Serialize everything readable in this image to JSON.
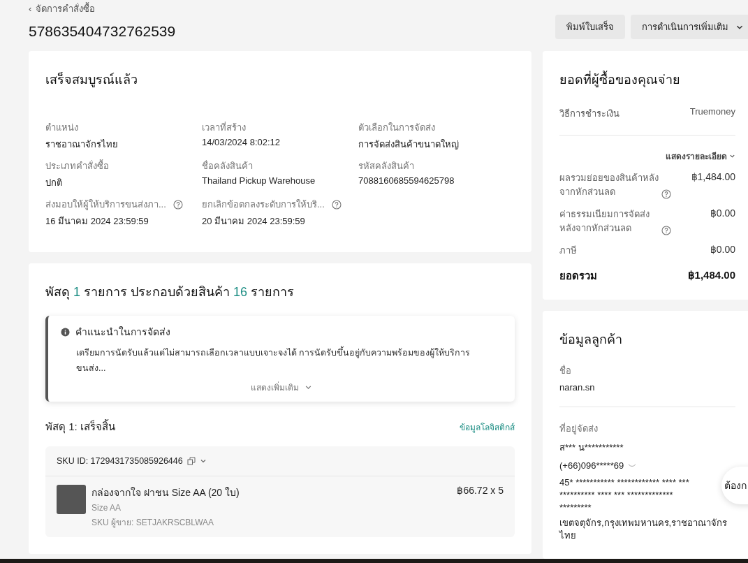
{
  "breadcrumb": {
    "icon": "‹",
    "label": "จัดการคำสั่งซื้อ"
  },
  "order_id": "578635404732762539",
  "header_buttons": [
    {
      "label": "พิมพ์ใบเสร็จ",
      "dropdown": false
    },
    {
      "label": "การดำเนินการเพิ่มเติม",
      "dropdown": true
    }
  ],
  "status_card": {
    "title": "เสร็จสมบูรณ์แล้ว",
    "fields": [
      {
        "label": "ตำแหน่ง",
        "value": "ราชอาณาจักรไทย",
        "help": false
      },
      {
        "label": "เวลาที่สร้าง",
        "value": "14/03/2024 8:02:12",
        "help": false
      },
      {
        "label": "ตัวเลือกในการจัดส่ง",
        "value": "การจัดส่งสินค้าขนาดใหญ่",
        "help": false
      },
      {
        "label": "ประเภทคำสั่งซื้อ",
        "value": "ปกติ",
        "help": false
      },
      {
        "label": "ชื่อคลังสินค้า",
        "value": "Thailand Pickup Warehouse",
        "help": false
      },
      {
        "label": "รหัสคลังสินค้า",
        "value": "7088160685594625798",
        "help": false
      },
      {
        "label": "ส่งมอบให้ผู้ให้บริการขนส่งภา...",
        "value": "16 มีนาคม 2024 23:59:59",
        "help": true
      },
      {
        "label": "ยกเลิกข้อตกลงระดับการให้บริ...",
        "value": "20 มีนาคม 2024 23:59:59",
        "help": true
      }
    ]
  },
  "packages_card": {
    "title_parts": [
      {
        "text": "พัสดุ ",
        "accent": false
      },
      {
        "text": "1",
        "accent": true
      },
      {
        "text": " รายการ ประกอบด้วยสินค้า ",
        "accent": false
      },
      {
        "text": "16",
        "accent": true
      },
      {
        "text": " รายการ",
        "accent": false
      }
    ],
    "tip": {
      "title": "คำแนะนำในการจัดส่ง",
      "body": "เตรียมการนัดรับแล้วแต่ไม่สามารถเลือกเวลาแบบเจาะจงได้ การนัดรับขึ้นอยู่กับความพร้อมของผู้ให้บริการขนส่ง...",
      "more": "แสดงเพิ่มเติม"
    },
    "package": {
      "title": "พัสดุ 1: เสร็จสิ้น",
      "link": "ข้อมูลโลจิสติกส์",
      "sku_id": "SKU ID: 1729431735085926446",
      "item": {
        "name": "กล่องจากใจ ฝาชน Size AA (20 ใบ)",
        "variant": "Size AA",
        "seller_sku": "SKU ผู้ขาย: SETJAKRSCBLWAA",
        "price": "฿66.72 x 5"
      }
    }
  },
  "payment_card": {
    "title": "ยอดที่ผู้ซื้อของคุณจ่าย",
    "method_label": "วิธีการชำระเงิน",
    "method_value": "Truemoney",
    "details_link": "แสดงรายละเอียด",
    "rows": [
      {
        "label": "ผลรวมย่อยของสินค้าหลังจากหักส่วนลด",
        "value": "฿1,484.00",
        "help": true,
        "kind": "normal"
      },
      {
        "label": "ค่าธรรมเนียมการจัดส่งหลังจากหักส่วนลด",
        "value": "฿0.00",
        "help": true,
        "kind": "normal"
      },
      {
        "label": "ภาษี",
        "value": "฿0.00",
        "help": false,
        "kind": "normal"
      },
      {
        "label": "ยอดรวม",
        "value": "฿1,484.00",
        "help": false,
        "kind": "total"
      }
    ]
  },
  "customer_card": {
    "title": "ข้อมูลลูกค้า",
    "name_label": "ชื่อ",
    "name": "naran.sn",
    "address_label": "ที่อยู่จัดส่ง",
    "recipient": "ส*** น***********",
    "phone": "(+66)096*****69",
    "address_lines": [
      "45* *********** ************ **** ***",
      "********** **** *** *************",
      "*********"
    ],
    "region": "เขตจตุจักร,กรุงเทพมหานคร,ราชอาณาจักรไทย"
  },
  "chat_bubble": "ต้องก"
}
